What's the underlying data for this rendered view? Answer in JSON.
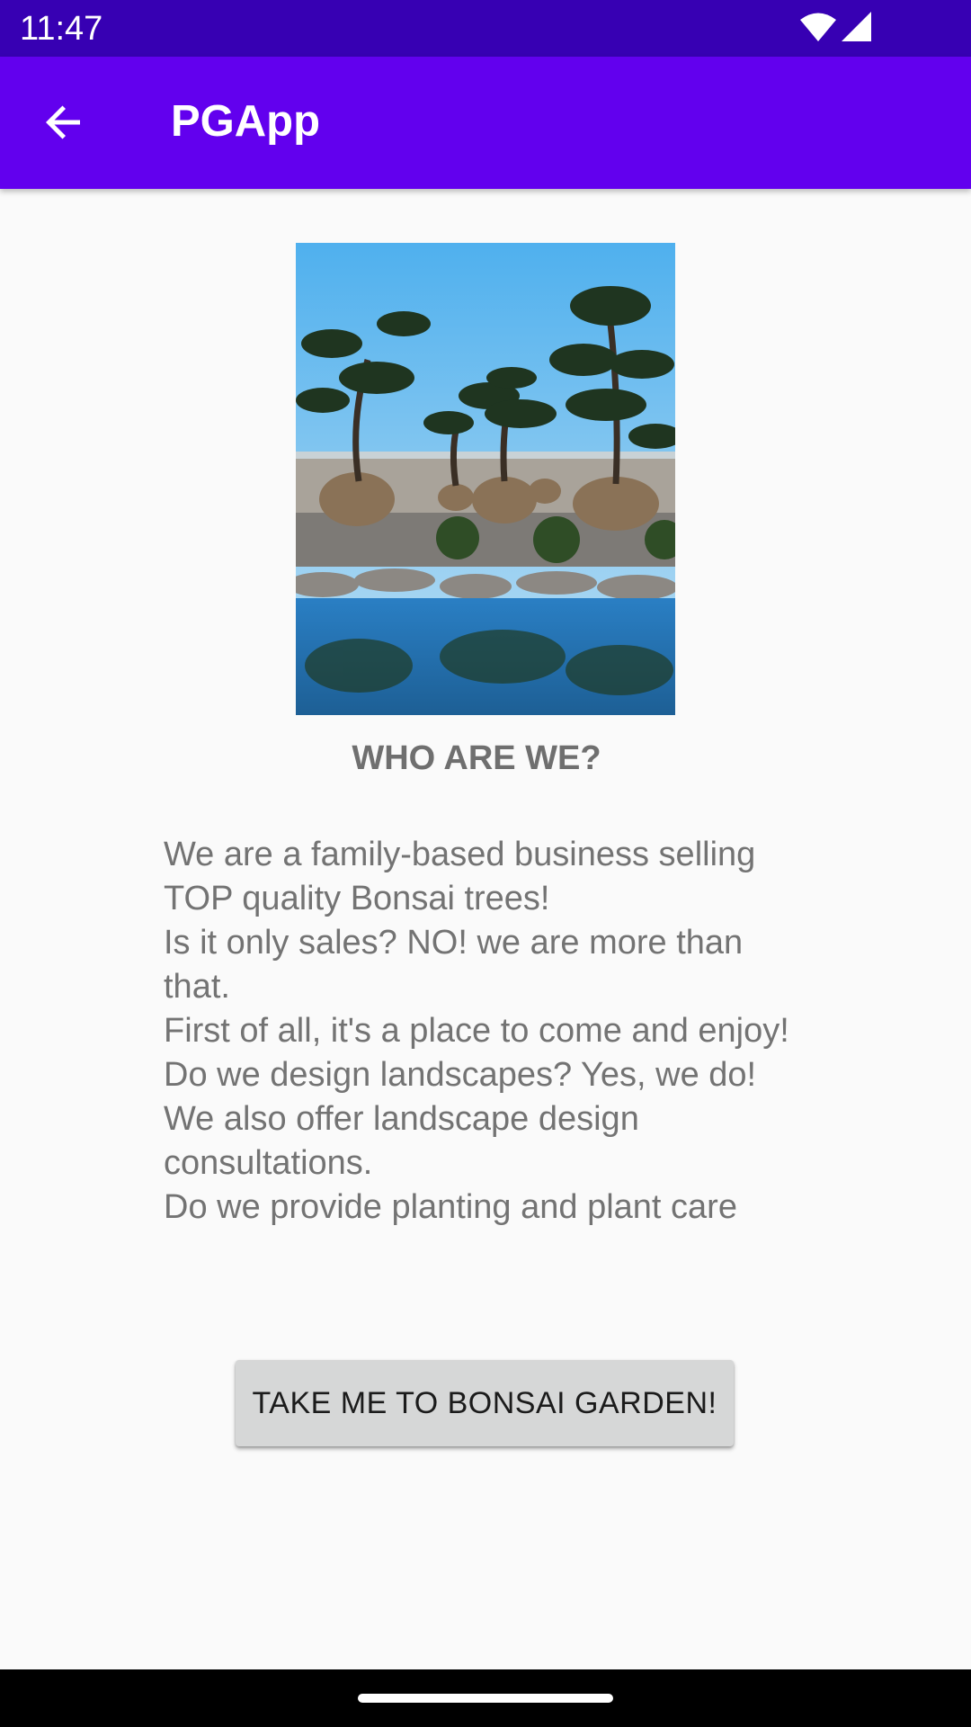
{
  "status_bar": {
    "time": "11:47",
    "icons": [
      "wifi-icon",
      "cell-signal-icon"
    ],
    "background": "#3700b3"
  },
  "app_bar": {
    "title": "PGApp",
    "back_icon": "arrow-back-icon",
    "background": "#6200ee"
  },
  "hero": {
    "image": "bonsai-garden-photo"
  },
  "heading": "WHO ARE WE?",
  "body": " We are a family-based business selling TOP quality Bonsai trees!\n Is it only sales? NO! we are more than that.\n First of all, it's a place to come and enjoy!\n Do we design landscapes? Yes, we do! We also offer landscape design consultations.\n Do we provide planting and plant care",
  "cta": {
    "label": "TAKE ME TO BONSAI GARDEN!"
  },
  "nav_bar": {
    "handle": "home-gesture-handle"
  }
}
